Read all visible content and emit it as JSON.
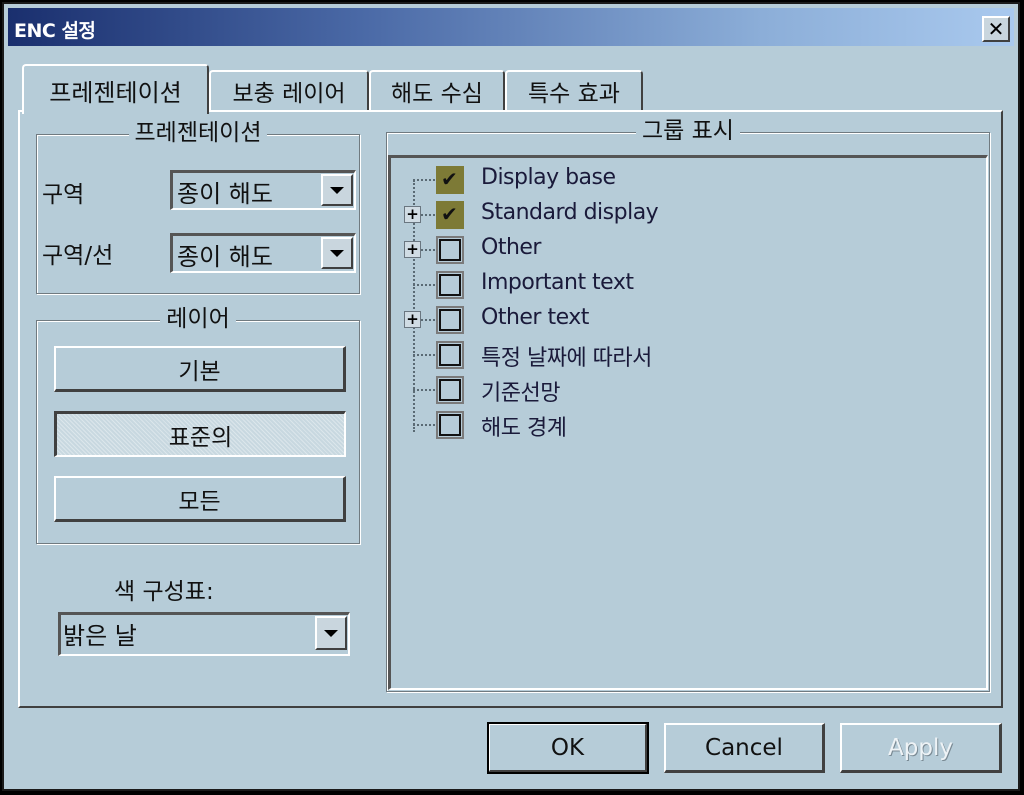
{
  "window": {
    "title": "ENC 설정",
    "close_icon": "close-x-icon"
  },
  "tabs": [
    {
      "label": "프레젠테이션",
      "active": true
    },
    {
      "label": "보충 레이어",
      "active": false
    },
    {
      "label": "해도 수심",
      "active": false
    },
    {
      "label": "특수 효과",
      "active": false
    }
  ],
  "presentation_group": {
    "title": "프레젠테이션",
    "area_label": "구역",
    "area_value": "종이 해도",
    "area_line_label": "구역/선",
    "area_line_value": "종이 해도"
  },
  "layer_group": {
    "title": "레이어",
    "buttons": [
      {
        "label": "기본",
        "pressed": false
      },
      {
        "label": "표준의",
        "pressed": true
      },
      {
        "label": "모든",
        "pressed": false
      }
    ]
  },
  "color_scheme": {
    "label": "색 구성표:",
    "value": "밝은 날"
  },
  "group_display": {
    "title": "그룹 표시",
    "items": [
      {
        "label": "Display base",
        "checked": true,
        "expandable": false
      },
      {
        "label": "Standard display",
        "checked": true,
        "expandable": true
      },
      {
        "label": "Other",
        "checked": false,
        "expandable": true
      },
      {
        "label": "Important text",
        "checked": false,
        "expandable": false
      },
      {
        "label": "Other text",
        "checked": false,
        "expandable": true
      },
      {
        "label": "특정 날짜에 따라서",
        "checked": false,
        "expandable": false
      },
      {
        "label": "기준선망",
        "checked": false,
        "expandable": false
      },
      {
        "label": "해도 경계",
        "checked": false,
        "expandable": false
      }
    ],
    "expander_glyph": "+",
    "check_glyph": "✔"
  },
  "footer": {
    "ok_label": "OK",
    "cancel_label": "Cancel",
    "apply_label": "Apply",
    "apply_enabled": false
  },
  "colors": {
    "dialog_bg": "#b6ccd8",
    "titlebar_start": "#1a2f6e",
    "titlebar_end": "#a9c9ee",
    "checked_box": "#7d7a36"
  }
}
